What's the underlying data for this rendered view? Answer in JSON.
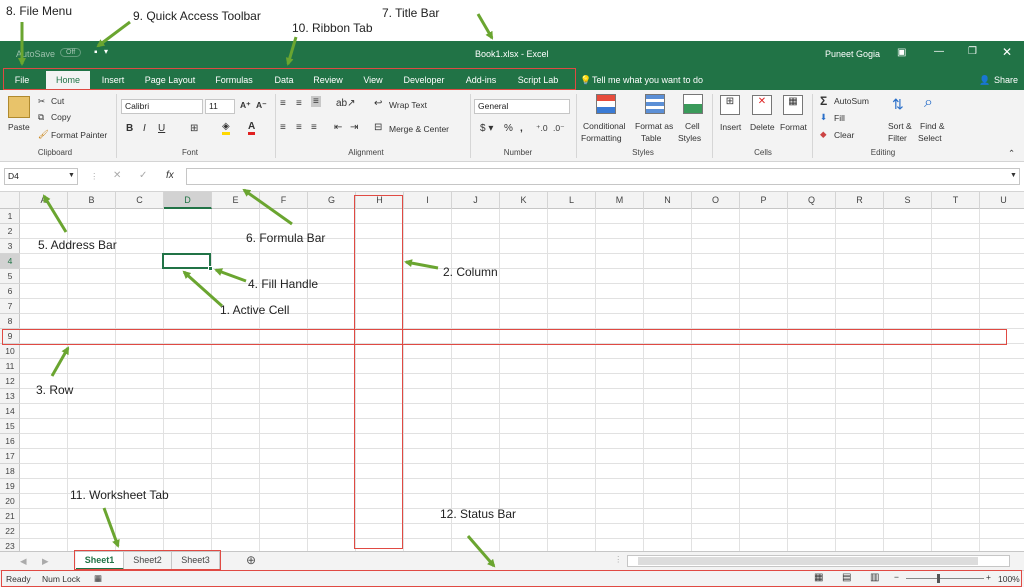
{
  "titlebar": {
    "autosave": "AutoSave",
    "autosave_state": "Off",
    "title": "Book1.xlsx - Excel",
    "user": "Puneet Gogia"
  },
  "tabs": [
    "File",
    "Home",
    "Insert",
    "Page Layout",
    "Formulas",
    "Data",
    "Review",
    "View",
    "Developer",
    "Add-ins",
    "Script Lab"
  ],
  "tell_me": "Tell me what you want to do",
  "share": "Share",
  "clipboard": {
    "paste": "Paste",
    "cut": "Cut",
    "copy": "Copy",
    "format_painter": "Format Painter",
    "group": "Clipboard"
  },
  "font": {
    "name": "Calibri",
    "size": "11",
    "group": "Font"
  },
  "alignment": {
    "wrap": "Wrap Text",
    "merge": "Merge & Center",
    "group": "Alignment"
  },
  "number": {
    "format": "General",
    "group": "Number"
  },
  "styles": {
    "cond1": "Conditional",
    "cond2": "Formatting",
    "fmt1": "Format as",
    "fmt2": "Table",
    "cell1": "Cell",
    "cell2": "Styles",
    "group": "Styles"
  },
  "cells_grp": {
    "insert": "Insert",
    "delete": "Delete",
    "format": "Format",
    "group": "Cells"
  },
  "editing": {
    "autosum": "AutoSum",
    "fill": "Fill",
    "clear": "Clear",
    "sort1": "Sort &",
    "sort2": "Filter",
    "find1": "Find &",
    "find2": "Select",
    "group": "Editing"
  },
  "namebox": "D4",
  "columns": [
    "A",
    "B",
    "C",
    "D",
    "E",
    "F",
    "G",
    "H",
    "I",
    "J",
    "K",
    "L",
    "M",
    "N",
    "O",
    "P",
    "Q",
    "R",
    "S",
    "T",
    "U"
  ],
  "rows": [
    "1",
    "2",
    "3",
    "4",
    "5",
    "6",
    "7",
    "8",
    "9",
    "10",
    "11",
    "12",
    "13",
    "14",
    "15",
    "16",
    "17",
    "18",
    "19",
    "20",
    "21",
    "22",
    "23"
  ],
  "sheets": [
    "Sheet1",
    "Sheet2",
    "Sheet3"
  ],
  "status": {
    "ready": "Ready",
    "numlock": "Num Lock",
    "zoom": "100%"
  },
  "annotations": {
    "a1": "1. Active Cell",
    "a2": "2. Column",
    "a3": "3. Row",
    "a4": "4. Fill Handle",
    "a5": "5. Address Bar",
    "a6": "6. Formula Bar",
    "a7": "7. Title Bar",
    "a8": "8. File Menu",
    "a9": "9. Quick Access Toolbar",
    "a10": "10. Ribbon Tab",
    "a11": "11. Worksheet Tab",
    "a12": "12. Status Bar"
  },
  "colors": {
    "excel_green": "#217346",
    "annotation_red": "#e04a43",
    "arrow_green": "#6aa530"
  }
}
